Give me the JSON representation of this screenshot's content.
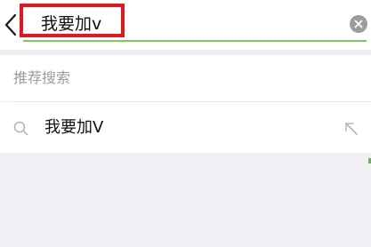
{
  "search": {
    "query": "我要加v",
    "placeholder": ""
  },
  "recommend": {
    "title": "推荐搜索"
  },
  "suggestions": [
    {
      "text": "我要加V"
    }
  ],
  "icons": {
    "back": "chevron-left-icon",
    "clear": "clear-icon",
    "search": "search-icon",
    "fill": "arrow-up-left-icon"
  },
  "colors": {
    "accent_green": "#7ccb62",
    "highlight_red": "#e4181e",
    "background": "#efeff4"
  }
}
